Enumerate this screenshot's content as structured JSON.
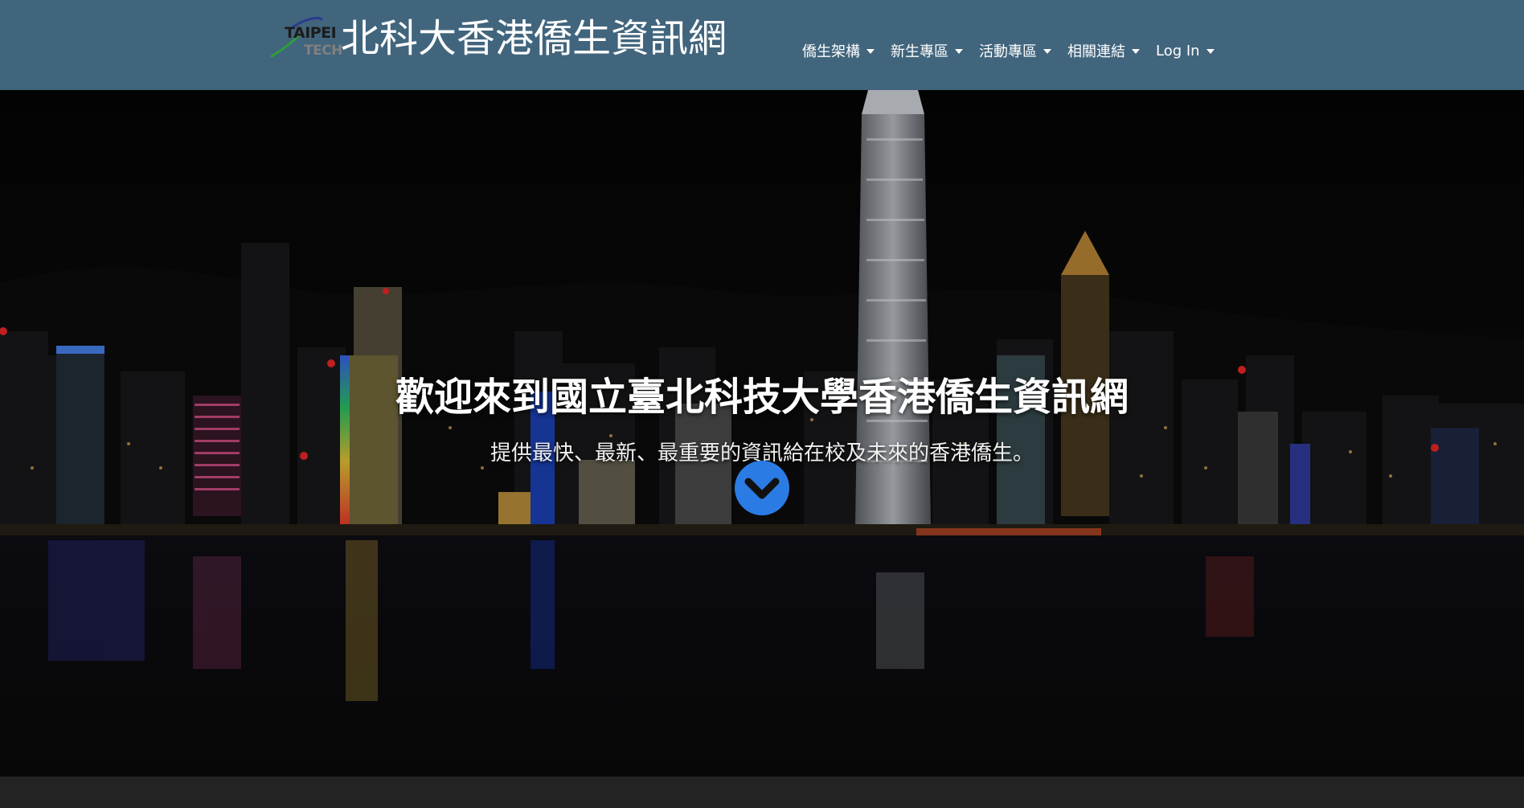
{
  "header": {
    "logo": {
      "line1": "TAIPEI",
      "line2": "TECH"
    },
    "site_title": "北科大香港僑生資訊網",
    "nav": [
      {
        "label": "僑生架構",
        "icon": "caret-down-icon"
      },
      {
        "label": "新生專區",
        "icon": "caret-down-icon"
      },
      {
        "label": "活動專區",
        "icon": "caret-down-icon"
      },
      {
        "label": "相關連結",
        "icon": "caret-down-icon"
      },
      {
        "label": "Log In",
        "icon": "caret-down-icon"
      }
    ]
  },
  "hero": {
    "title": "歡迎來到國立臺北科技大學香港僑生資訊網",
    "subtitle": "提供最快、最新、最重要的資訊給在校及未來的香港僑生。",
    "scroll_button_icon": "chevron-down-icon"
  },
  "colors": {
    "navbar": "#41657d",
    "accent": "#2b7be4",
    "footer": "#232323"
  }
}
